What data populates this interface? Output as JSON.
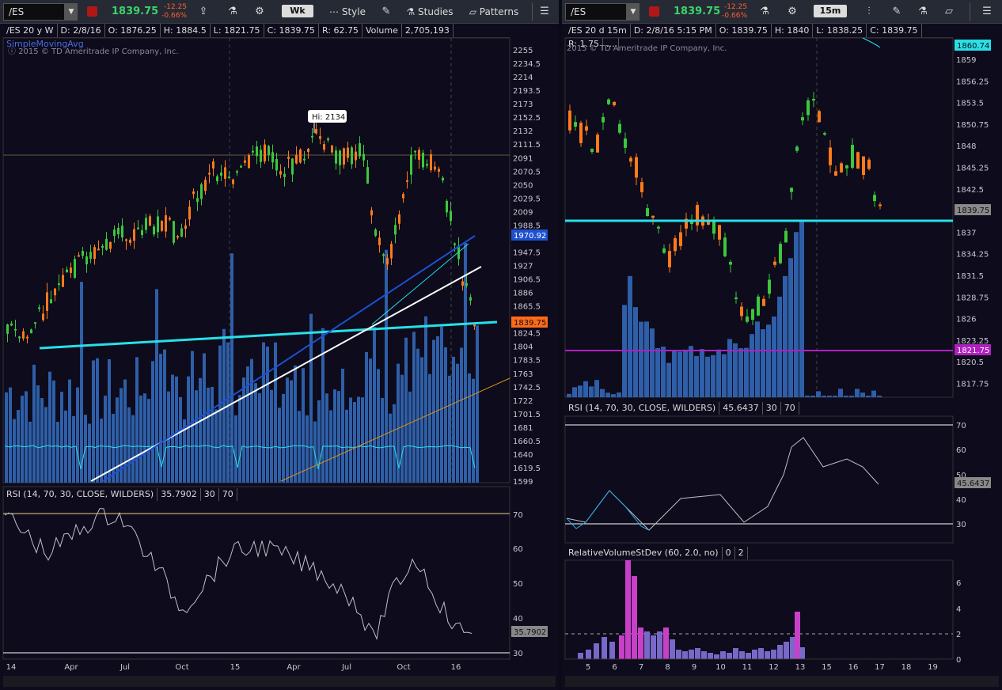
{
  "left": {
    "symbol": "/ES",
    "price": "1839.75",
    "change": "-12.25",
    "change_pct": "-0.66%",
    "aggregation": "Wk",
    "style_label": "Style",
    "studies_label": "Studies",
    "patterns_label": "Patterns",
    "header": [
      "/ES 20 y W",
      "D: 2/8/16",
      "O: 1876.25",
      "H: 1884.5",
      "L: 1821.75",
      "C: 1839.75",
      "R: 62.75",
      "Volume",
      "2,705,193"
    ],
    "sma_label": "SimpleMovingAvg",
    "copyright": "2015 © TD Ameritrade IP Company, Inc.",
    "hi_label": "Hi: 2134",
    "price_axis": [
      "2255",
      "2234.5",
      "2214",
      "2193.5",
      "2173",
      "2152.5",
      "2132",
      "2111.5",
      "2091",
      "2070.5",
      "2050",
      "2029.5",
      "2009",
      "1988.5",
      "1968",
      "1947.5",
      "1927",
      "1906.5",
      "1886",
      "1865.5",
      "1845",
      "1824.5",
      "1804",
      "1783.5",
      "1763",
      "1742.5",
      "1722",
      "1701.5",
      "1681",
      "1660.5",
      "1640",
      "1619.5",
      "1599"
    ],
    "sma_tag": "1970.92",
    "price_tag": "1839.75",
    "rsi_header": [
      "RSI (14, 70, 30, CLOSE, WILDERS)",
      "35.7902",
      "30",
      "70"
    ],
    "rsi_axis": [
      "70",
      "60",
      "50",
      "40",
      "30"
    ],
    "rsi_tag": "35.7902",
    "time_axis": [
      "14",
      "Apr",
      "Jul",
      "Oct",
      "15",
      "Apr",
      "Jul",
      "Oct",
      "16"
    ],
    "year_marks": [
      "Year",
      "Year",
      "Year"
    ]
  },
  "right": {
    "symbol": "/ES",
    "price": "1839.75",
    "change": "-12.25",
    "change_pct": "-0.66%",
    "aggregation": "15m",
    "header": [
      "/ES 20 d 15m",
      "D: 2/8/16 5:15 PM",
      "O: 1839.75",
      "H: 1840",
      "L: 1838.25",
      "C: 1839.75",
      "R: 1.75",
      "..."
    ],
    "copyright": "2015 © TD Ameritrade IP Company, Inc.",
    "price_axis": [
      "1859",
      "1856.25",
      "1853.5",
      "1850.75",
      "1848",
      "1845.25",
      "1842.5",
      "1839.75",
      "1837",
      "1834.25",
      "1831.5",
      "1828.75",
      "1826",
      "1823.25",
      "1820.5",
      "1817.75"
    ],
    "top_tag": "1860.74",
    "price_tag": "1839.75",
    "support_tag": "1821.75",
    "rsi_header": [
      "RSI (14, 70, 30, CLOSE, WILDERS)",
      "45.6437",
      "30",
      "70"
    ],
    "rsi_axis": [
      "70",
      "60",
      "50",
      "40",
      "30"
    ],
    "rsi_tag": "45.6437",
    "rv_header": [
      "RelativeVolumeStDev (60, 2.0, no)",
      "0",
      "2"
    ],
    "rv_axis": [
      "6",
      "4",
      "2",
      "0"
    ],
    "time_axis": [
      "5",
      "6",
      "7",
      "8",
      "9",
      "10",
      "11",
      "12",
      "13",
      "15",
      "16",
      "17",
      "18",
      "19"
    ]
  },
  "colors": {
    "up": "#3cc83c",
    "down": "#ff7a1a",
    "volume": "#2e5fa8",
    "cyan": "#27e0e8",
    "sma": "#1e50d0",
    "support": "#b020c0"
  }
}
